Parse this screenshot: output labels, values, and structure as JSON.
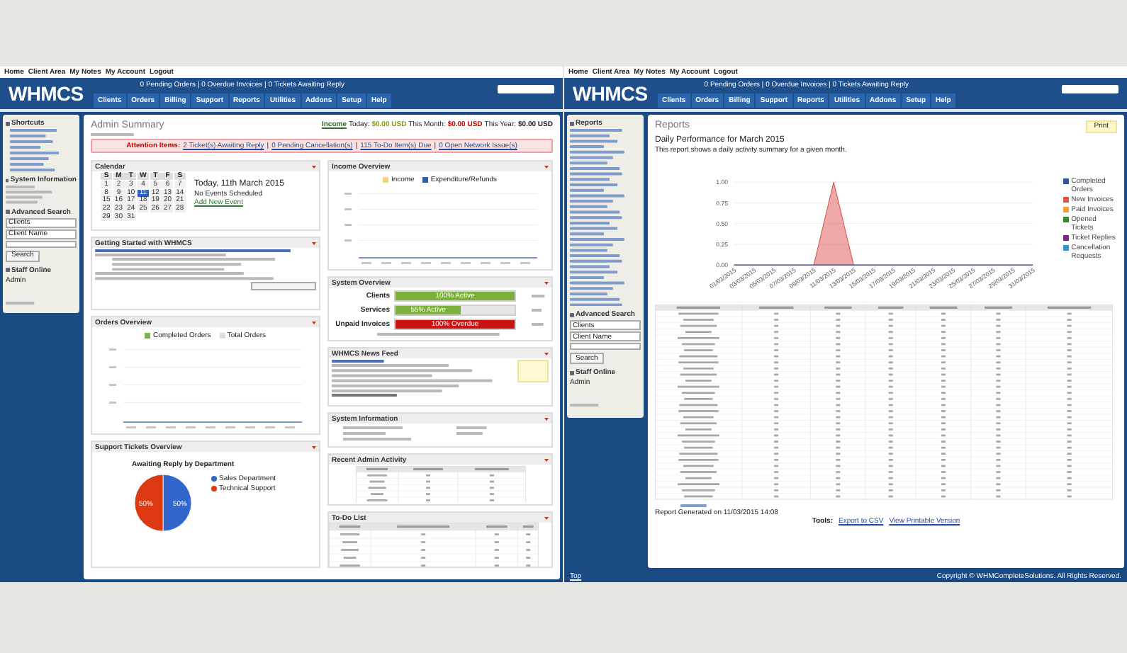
{
  "left_screen": {
    "top_links": [
      "Home",
      "Client Area",
      "My Notes",
      "My Account",
      "Logout"
    ],
    "header": {
      "logo": "WHMCS",
      "status_line": "0 Pending Orders | 0 Overdue Invoices | 0 Tickets Awaiting Reply",
      "nav": [
        "Clients",
        "Orders",
        "Billing",
        "Support",
        "Reports",
        "Utilities",
        "Addons",
        "Setup",
        "Help"
      ]
    },
    "sidebar": {
      "shortcuts_title": "Shortcuts",
      "info_title": "System Information",
      "advanced_search": {
        "title": "Advanced Search",
        "selects": [
          "Clients",
          "Client Name"
        ],
        "button": "Search"
      },
      "staff_online": {
        "title": "Staff Online",
        "names": [
          "Admin"
        ]
      }
    },
    "page_title": "Admin Summary",
    "income": {
      "label": "Income",
      "parts": [
        {
          "label": "Today:",
          "value": "$0.00 USD",
          "color": "#8a9a00"
        },
        {
          "label": "This Month:",
          "value": "$0.00 USD",
          "color": "#cc0000"
        },
        {
          "label": "This Year:",
          "value": "$0.00 USD",
          "color": "#222222"
        }
      ]
    },
    "attention": {
      "label": "Attention Items:",
      "separator": "|",
      "items": [
        "2 Ticket(s) Awaiting Reply",
        "0 Pending Cancellation(s)",
        "115 To-Do Item(s) Due",
        "0 Open Network Issue(s)"
      ]
    },
    "calendar": {
      "title": "Calendar",
      "weekdays": [
        "S",
        "M",
        "T",
        "W",
        "T",
        "F",
        "S"
      ],
      "days": [
        {
          "label": "1",
          "selected": false
        },
        {
          "label": "2",
          "selected": false
        },
        {
          "label": "3",
          "selected": false
        },
        {
          "label": "4",
          "selected": false
        },
        {
          "label": "5",
          "selected": false
        },
        {
          "label": "6",
          "selected": false
        },
        {
          "label": "7",
          "selected": false
        },
        {
          "label": "8",
          "selected": false
        },
        {
          "label": "9",
          "selected": false
        },
        {
          "label": "10",
          "selected": false
        },
        {
          "label": "11",
          "selected": true
        },
        {
          "label": "12",
          "selected": false
        },
        {
          "label": "13",
          "selected": false
        },
        {
          "label": "14",
          "selected": false
        },
        {
          "label": "15",
          "selected": false
        },
        {
          "label": "16",
          "selected": false
        },
        {
          "label": "17",
          "selected": false
        },
        {
          "label": "18",
          "selected": false
        },
        {
          "label": "19",
          "selected": false
        },
        {
          "label": "20",
          "selected": false
        },
        {
          "label": "21",
          "selected": false
        },
        {
          "label": "22",
          "selected": false
        },
        {
          "label": "23",
          "selected": false
        },
        {
          "label": "24",
          "selected": false
        },
        {
          "label": "25",
          "selected": false
        },
        {
          "label": "26",
          "selected": false
        },
        {
          "label": "27",
          "selected": false
        },
        {
          "label": "28",
          "selected": false
        },
        {
          "label": "29",
          "selected": false
        },
        {
          "label": "30",
          "selected": false
        },
        {
          "label": "31",
          "selected": false
        }
      ],
      "today": "Today, 11th March 2015",
      "no_events": "No Events Scheduled",
      "add_event": "Add New Event"
    },
    "getting_started": {
      "title": "Getting Started with WHMCS"
    },
    "orders_overview": {
      "title": "Orders Overview",
      "legend": [
        "Completed Orders",
        "Total Orders"
      ]
    },
    "support_tickets": {
      "title": "Support Tickets Overview",
      "chart_data": {
        "type": "pie",
        "title": "Awaiting Reply by Department",
        "categories": [
          "Sales Department",
          "Technical Support"
        ],
        "series": [
          {
            "values": [
              50,
              50
            ]
          }
        ],
        "colors": [
          "#3366cc",
          "#dc3912"
        ],
        "value_labels": [
          "50%",
          "50%"
        ],
        "legend": "right"
      }
    },
    "income_overview": {
      "title": "Income Overview",
      "legend": [
        "Income",
        "Expenditure/Refunds"
      ]
    },
    "system_overview": {
      "title": "System Overview",
      "rows": [
        {
          "label": "Clients",
          "bar_text": "100% Active",
          "level": 1,
          "kind": "good"
        },
        {
          "label": "Services",
          "bar_text": "55% Active",
          "level": 0.55,
          "kind": "good"
        },
        {
          "label": "Unpaid Invoices",
          "bar_text": "100% Overdue",
          "level": 1,
          "kind": "bad"
        }
      ]
    },
    "news_feed": {
      "title": "WHMCS News Feed"
    },
    "system_info": {
      "title": "System Information"
    },
    "admin_activity": {
      "title": "Recent Admin Activity"
    },
    "todo": {
      "title": "To-Do List"
    }
  },
  "right_screen": {
    "top_links": [
      "Home",
      "Client Area",
      "My Notes",
      "My Account",
      "Logout"
    ],
    "header": {
      "logo": "WHMCS",
      "status_line": "0 Pending Orders | 0 Overdue Invoices | 0 Tickets Awaiting Reply",
      "nav": [
        "Clients",
        "Orders",
        "Billing",
        "Support",
        "Reports",
        "Utilities",
        "Addons",
        "Setup",
        "Help"
      ]
    },
    "sidebar": {
      "reports_title": "Reports",
      "advanced_search": {
        "title": "Advanced Search",
        "selects": [
          "Clients",
          "Client Name"
        ],
        "button": "Search"
      },
      "staff_online": {
        "title": "Staff Online",
        "names": [
          "Admin"
        ]
      }
    },
    "page_title": "Reports",
    "print": "Print",
    "report_title": "Daily Performance for March 2015",
    "description": "This report shows a daily activity summary for a given month.",
    "chart_data": {
      "type": "area",
      "categories": [
        "01/03/2015",
        "03/03/2015",
        "05/03/2015",
        "07/03/2015",
        "09/03/2015",
        "11/03/2015",
        "13/03/2015",
        "15/03/2015",
        "17/03/2015",
        "19/03/2015",
        "21/03/2015",
        "23/03/2015",
        "25/03/2015",
        "27/03/2015",
        "29/03/2015",
        "31/03/2015"
      ],
      "ylim": [
        0,
        1
      ],
      "yticks": [
        {
          "value": 0,
          "label": "0.00"
        },
        {
          "value": 0.25,
          "label": "0.25"
        },
        {
          "value": 0.5,
          "label": "0.50"
        },
        {
          "value": 0.75,
          "label": "0.75"
        },
        {
          "value": 1,
          "label": "1.00"
        }
      ],
      "grid": true,
      "series": [
        {
          "color": "#d9534f",
          "values": [
            0,
            0,
            0,
            0,
            0,
            1,
            0,
            0,
            0,
            0,
            0,
            0,
            0,
            0,
            0,
            0
          ]
        }
      ]
    },
    "chart_legend": [
      {
        "name": "Completed Orders",
        "color": "#3355aa"
      },
      {
        "name": "New Invoices",
        "color": "#d9534f"
      },
      {
        "name": "Paid Invoices",
        "color": "#f0a030"
      },
      {
        "name": "Opened Tickets",
        "color": "#2e8b2e"
      },
      {
        "name": "Ticket Replies",
        "color": "#7b2c8f"
      },
      {
        "name": "Cancellation Requests",
        "color": "#2e9ad0"
      }
    ],
    "generated": "Report Generated on 11/03/2015 14:08",
    "tools": {
      "label": "Tools:",
      "links": [
        "Export to CSV",
        "View Printable Version"
      ]
    },
    "footer": {
      "top": "Top",
      "copyright": "Copyright © WHMCompleteSolutions. All Rights Reserved."
    }
  }
}
